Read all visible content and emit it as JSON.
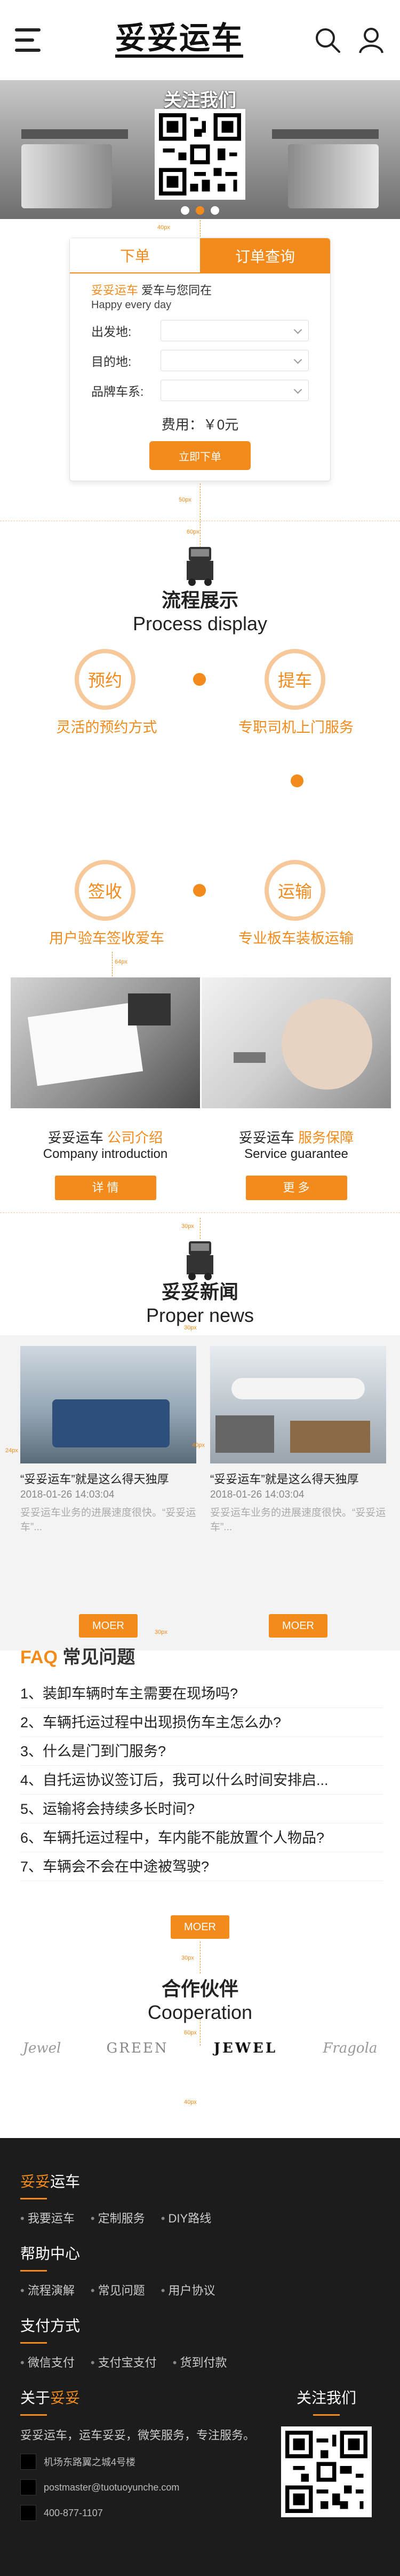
{
  "header": {
    "logo": "妥妥运车",
    "menu_icon": "hamburger-menu-icon",
    "search_icon": "search-icon",
    "user_icon": "user-icon"
  },
  "banner": {
    "title": "关注我们"
  },
  "order": {
    "tab_order": "下单",
    "tab_query": "订单查询",
    "slogan_brand": "妥妥运车",
    "slogan_rest": " 爱车与您同在",
    "slogan_en": "Happy every day",
    "fields": [
      {
        "label": "出发地:"
      },
      {
        "label": "目的地:"
      },
      {
        "label": "品牌车系:"
      }
    ],
    "fee_label": "费用：￥0元",
    "submit": "立即下单"
  },
  "measures": {
    "m1": "40px",
    "m2": "50px",
    "m3": "60px",
    "m4": "64px",
    "m5": "30px",
    "m6": "30px",
    "m7": "40px",
    "m8": "24px",
    "m9": "30px",
    "m10": "30px",
    "m11": "60px",
    "m12": "40px"
  },
  "process": {
    "title_cn": "流程展示",
    "title_en": "Process display",
    "steps": [
      {
        "circle": "预约",
        "label": "灵活的预约方式"
      },
      {
        "circle": "提车",
        "label": "专职司机上门服务"
      },
      {
        "circle": "签收",
        "label": "用户验车签收爱车"
      },
      {
        "circle": "运输",
        "label": "专业板车装板运输"
      }
    ]
  },
  "intro": [
    {
      "brand": "妥妥运车",
      "tag": "公司介绍",
      "en": "Company introduction",
      "btn": "详 情"
    },
    {
      "brand": "妥妥运车",
      "tag": "服务保障",
      "en": "Service guarantee",
      "btn": "更 多"
    }
  ],
  "news": {
    "title_cn": "妥妥新闻",
    "title_en": "Proper news",
    "items": [
      {
        "title": "“妥妥运车”就是这么得天独厚",
        "date": "2018-01-26 14:03:04",
        "desc": "妥妥运车业务的进展速度很快。“妥妥运车”..."
      },
      {
        "title": "“妥妥运车”就是这么得天独厚",
        "date": "2018-01-26 14:03:04",
        "desc": "妥妥运车业务的进展速度很快。“妥妥运车”..."
      }
    ],
    "more": "MOER"
  },
  "faq": {
    "title_f": "FAQ",
    "title_rest": " 常见问题",
    "items": [
      "1、装卸车辆时车主需要在现场吗?",
      "2、车辆托运过程中出现损伤车主怎么办?",
      "3、什么是门到门服务?",
      "4、自托运协议签订后，我可以什么时间安排启...",
      "5、运输将会持续多长时间?",
      "6、车辆托运过程中，车内能不能放置个人物品?",
      "7、车辆会不会在中途被驾驶?"
    ],
    "more": "MOER"
  },
  "coop": {
    "title_cn": "合作伙伴",
    "title_en": "Cooperation",
    "partners": [
      "Jewel",
      "GREEN",
      "JEWEL",
      "Fragola"
    ]
  },
  "footer": {
    "brand_a": "妥妥",
    "brand_b": "运车",
    "links1": [
      "我要运车",
      "定制服务",
      "DIY路线"
    ],
    "help": "帮助中心",
    "links2": [
      "流程演解",
      "常见问题",
      "用户协议"
    ],
    "pay": "支付方式",
    "links3": [
      "微信支付",
      "支付宝支付",
      "货到付款"
    ],
    "about_a": "关于",
    "about_b": "妥妥",
    "follow": "关注我们",
    "about_text": "妥妥运车，运车妥妥，微笑服务，专注服务。",
    "address": "机场东路翼之城4号楼",
    "email": "postmaster@tuotuoyunche.com",
    "phone": "400-877-1107"
  },
  "colors": {
    "accent": "#f28b1b",
    "footer_bg": "#1c1c1c"
  }
}
